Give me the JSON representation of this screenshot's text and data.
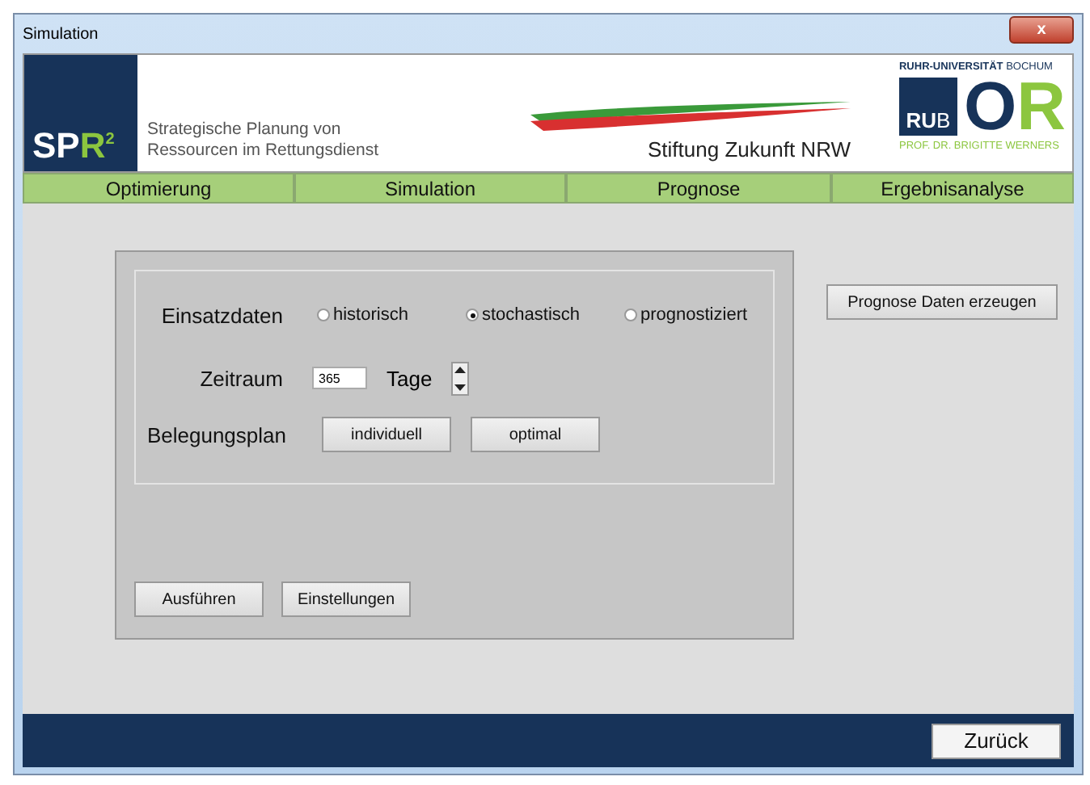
{
  "window": {
    "title": "Simulation",
    "close": "x"
  },
  "header": {
    "logo_main": "SP",
    "logo_accent": "R",
    "logo_sup": "2",
    "tagline": [
      "Strategische Planung von",
      "Ressourcen im Rettungsdienst"
    ],
    "foundation": "Stiftung Zukunft NRW",
    "university": "**RUHR-UNIVERSITÄT** BOCHUM",
    "rub_main": "RU",
    "rub_tail": "B",
    "or_first": "O",
    "or_second": "R",
    "professor": "PROF. DR. BRIGITTE WERNERS"
  },
  "tabs": [
    {
      "label": "Optimierung"
    },
    {
      "label": "Simulation"
    },
    {
      "label": "Prognose"
    },
    {
      "label": "Ergebnisanalyse"
    }
  ],
  "einsatzdaten": {
    "label": "Einsatzdaten",
    "options": [
      {
        "label": "historisch",
        "selected": false
      },
      {
        "label": "stochastisch",
        "selected": true
      },
      {
        "label": "prognostiziert",
        "selected": false
      }
    ]
  },
  "zeitraum": {
    "label": "Zeitraum",
    "value": "365",
    "unit": "Tage"
  },
  "belegungsplan": {
    "label": "Belegungsplan",
    "buttons": [
      "individuell",
      "optimal"
    ]
  },
  "actions": [
    "Ausführen",
    "Einstellungen"
  ],
  "side_button": "Prognose Daten erzeugen",
  "footer_button": "Zurück"
}
